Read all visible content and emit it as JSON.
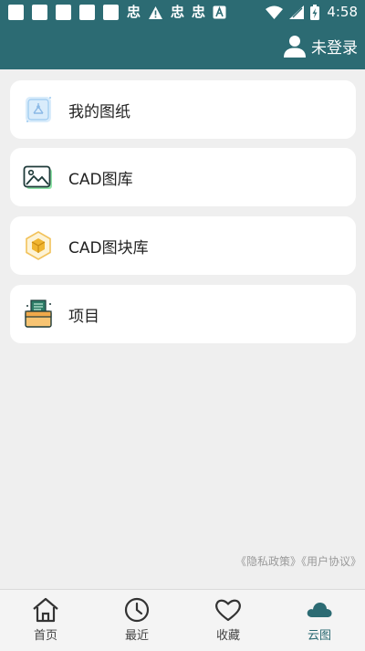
{
  "status_bar": {
    "notif_glyph": "忠",
    "time": "4:58"
  },
  "header": {
    "account_label": "未登录",
    "accent_color": "#2c6b73"
  },
  "menu": {
    "items": [
      {
        "label": "我的图纸",
        "icon": "blueprint-icon"
      },
      {
        "label": "CAD图库",
        "icon": "picture-gallery-icon"
      },
      {
        "label": "CAD图块库",
        "icon": "block-cube-icon"
      },
      {
        "label": "项目",
        "icon": "project-folder-icon"
      }
    ]
  },
  "footer": {
    "privacy_link": "《隐私政策》",
    "agreement_link": "《用户协议》"
  },
  "tabbar": {
    "tabs": [
      {
        "label": "首页",
        "icon": "home-icon"
      },
      {
        "label": "最近",
        "icon": "clock-icon"
      },
      {
        "label": "收藏",
        "icon": "heart-icon"
      },
      {
        "label": "云图",
        "icon": "cloud-icon",
        "active": true
      }
    ]
  }
}
